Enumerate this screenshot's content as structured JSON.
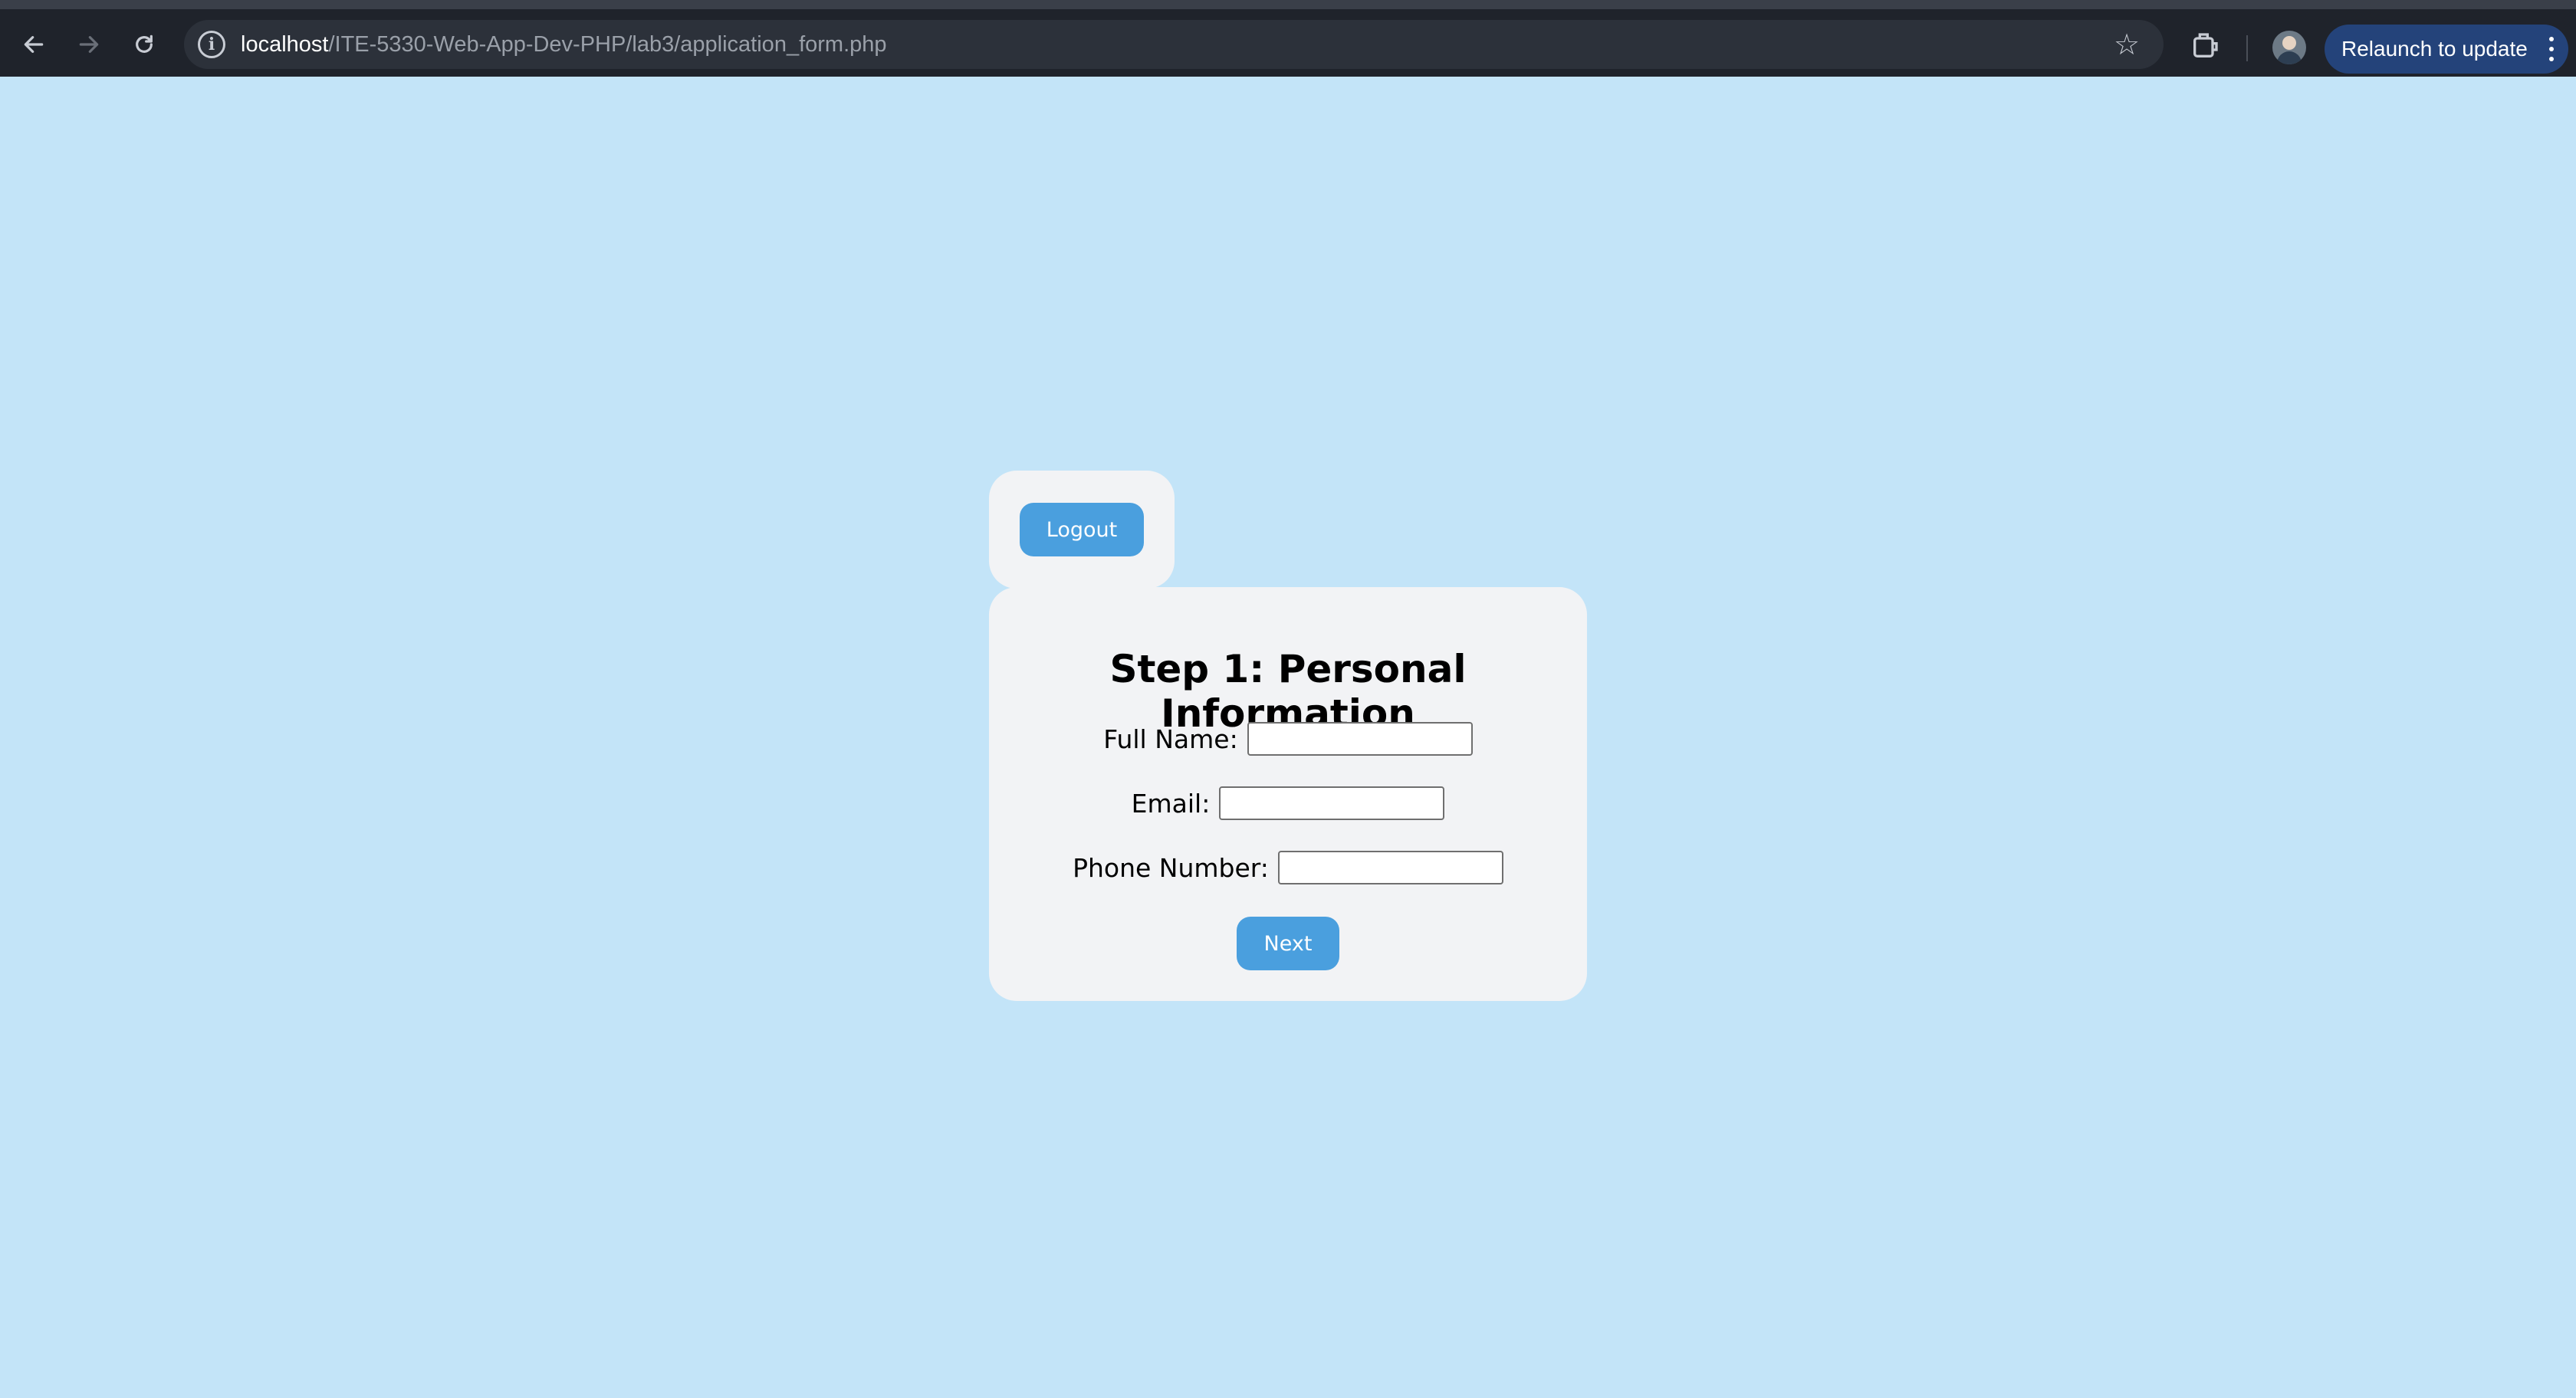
{
  "browser": {
    "url_host": "localhost",
    "url_path": "/ITE-5330-Web-App-Dev-PHP/lab3/application_form.php",
    "relaunch_label": "Relaunch to update"
  },
  "page": {
    "logout_label": "Logout",
    "form": {
      "title": "Step 1: Personal Information",
      "fields": [
        {
          "label": "Full Name:",
          "value": ""
        },
        {
          "label": "Email:",
          "value": ""
        },
        {
          "label": "Phone Number:",
          "value": ""
        }
      ],
      "next_label": "Next"
    }
  },
  "colors": {
    "page_background": "#c3e4f8",
    "card_background": "#f2f3f5",
    "button": "#4a9fde",
    "chrome": "#1f232b",
    "relaunch_button": "#24437a"
  }
}
